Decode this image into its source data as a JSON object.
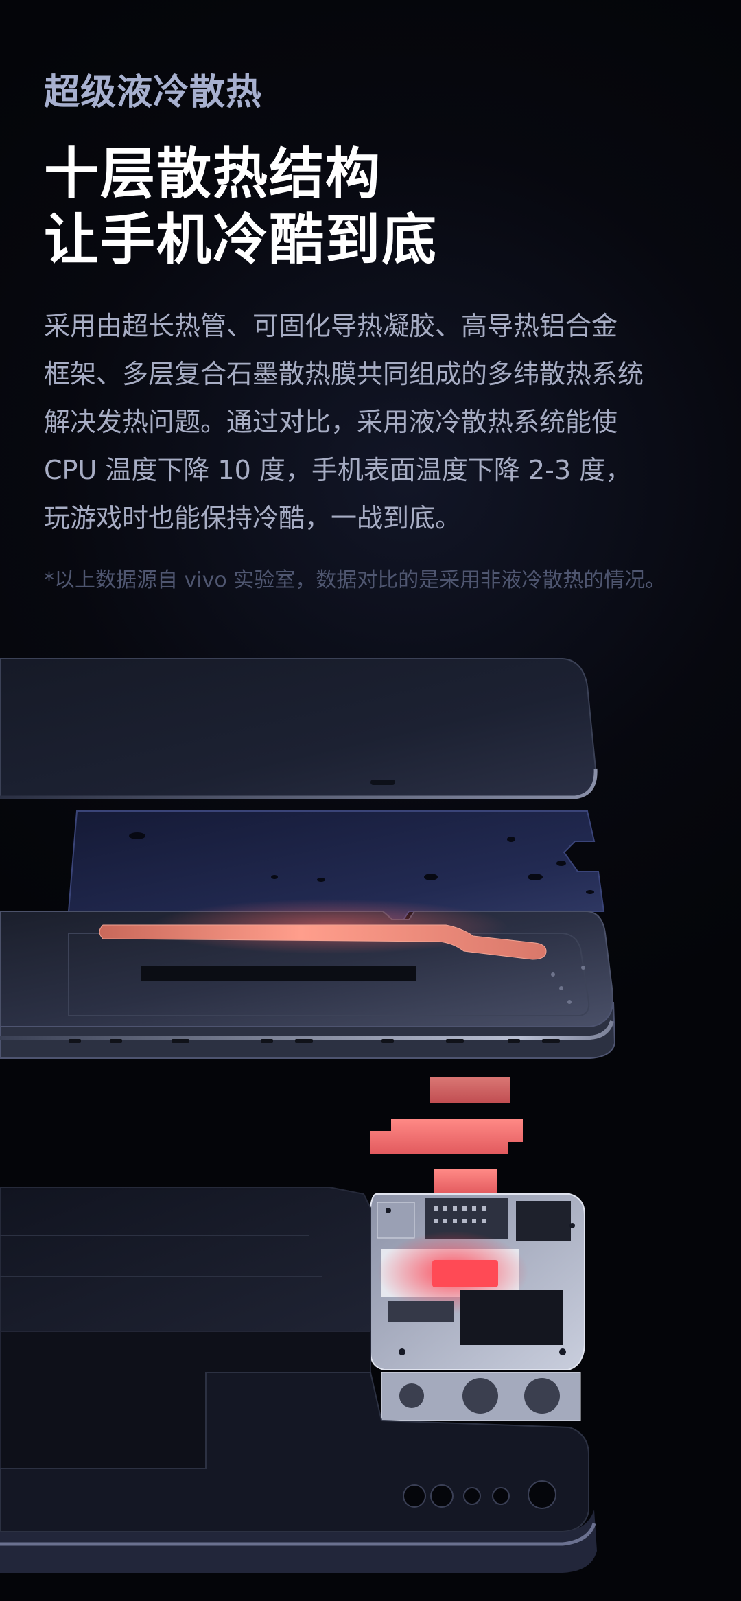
{
  "section": {
    "eyebrow": "超级液冷散热",
    "headline_line1": "十层散热结构",
    "headline_line2": "让手机冷酷到底",
    "body_line1": "采用由超长热管、可固化导热凝胶、高导热铝合金",
    "body_line2": "框架、多层复合石墨散热膜共同组成的多纬散热系统",
    "body_line3": "解决发热问题。通过对比，采用液冷散热系统能使",
    "body_line4": "CPU 温度下降 10 度，手机表面温度下降 2-3 度，",
    "body_line5": "玩游戏时也能保持冷酷，一战到底。",
    "footnote": "*以上数据源自 vivo 实验室，数据对比的是采用非液冷散热的情况。"
  },
  "colors": {
    "eyebrow": "#a7b0cf",
    "headline": "#ffffff",
    "body": "#a7adc4",
    "footnote": "#4f5670",
    "heat": "#ff5a5a"
  }
}
